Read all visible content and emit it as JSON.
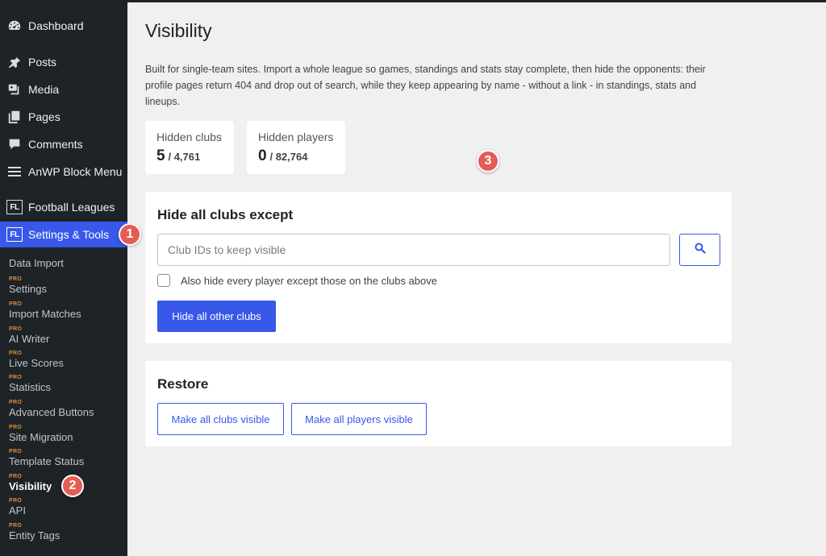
{
  "sidebar": {
    "items": [
      {
        "label": "Dashboard",
        "icon": "dashboard-icon"
      },
      {
        "label": "Posts",
        "icon": "pin-icon"
      },
      {
        "label": "Media",
        "icon": "media-icon"
      },
      {
        "label": "Pages",
        "icon": "pages-icon"
      },
      {
        "label": "Comments",
        "icon": "comment-icon"
      },
      {
        "label": "AnWP Block Menu",
        "icon": "menu-lines-icon"
      },
      {
        "label": "Football Leagues",
        "icon": "fl-logo-icon",
        "logo_text": "FL"
      },
      {
        "label": "Settings & Tools",
        "icon": "fl-logo-icon",
        "logo_text": "FL",
        "active": true
      }
    ],
    "submenu": [
      {
        "label": "Data Import",
        "pro": ""
      },
      {
        "label": "Settings",
        "pro": "PRO"
      },
      {
        "label": "Import Matches",
        "pro": "PRO"
      },
      {
        "label": "AI Writer",
        "pro": "PRO"
      },
      {
        "label": "Live Scores",
        "pro": "PRO"
      },
      {
        "label": "Statistics",
        "pro": "PRO"
      },
      {
        "label": "Advanced Buttons",
        "pro": "PRO"
      },
      {
        "label": "Site Migration",
        "pro": "PRO"
      },
      {
        "label": "Template Status",
        "pro": "PRO"
      },
      {
        "label": "Visibility",
        "pro": "PRO",
        "current": true
      },
      {
        "label": "API",
        "pro": "PRO"
      },
      {
        "label": "Entity Tags",
        "pro": "PRO"
      }
    ]
  },
  "badges": [
    "1",
    "2",
    "3"
  ],
  "page": {
    "title": "Visibility",
    "description": "Built for single-team sites. Import a whole league so games, standings and stats stay complete, then hide the opponents: their profile pages return 404 and drop out of search, while they keep appearing by name - without a link - in standings, stats and lineups."
  },
  "stats": [
    {
      "label": "Hidden clubs",
      "value": "5",
      "total": "/ 4,761"
    },
    {
      "label": "Hidden players",
      "value": "0",
      "total": "/ 82,764"
    }
  ],
  "hide_panel": {
    "title": "Hide all clubs except",
    "input_placeholder": "Club IDs to keep visible",
    "input_value": "",
    "checkbox_label": "Also hide every player except those on the clubs above",
    "checkbox_checked": false,
    "submit_label": "Hide all other clubs",
    "search_icon": "search-icon"
  },
  "restore_panel": {
    "title": "Restore",
    "clubs_button": "Make all clubs visible",
    "players_button": "Make all players visible"
  },
  "colors": {
    "sidebar_bg": "#1d2327",
    "accent": "#3858e9",
    "pro_badge": "#d98e3a",
    "marker": "#e45c54",
    "page_bg": "#f0f0f1"
  }
}
